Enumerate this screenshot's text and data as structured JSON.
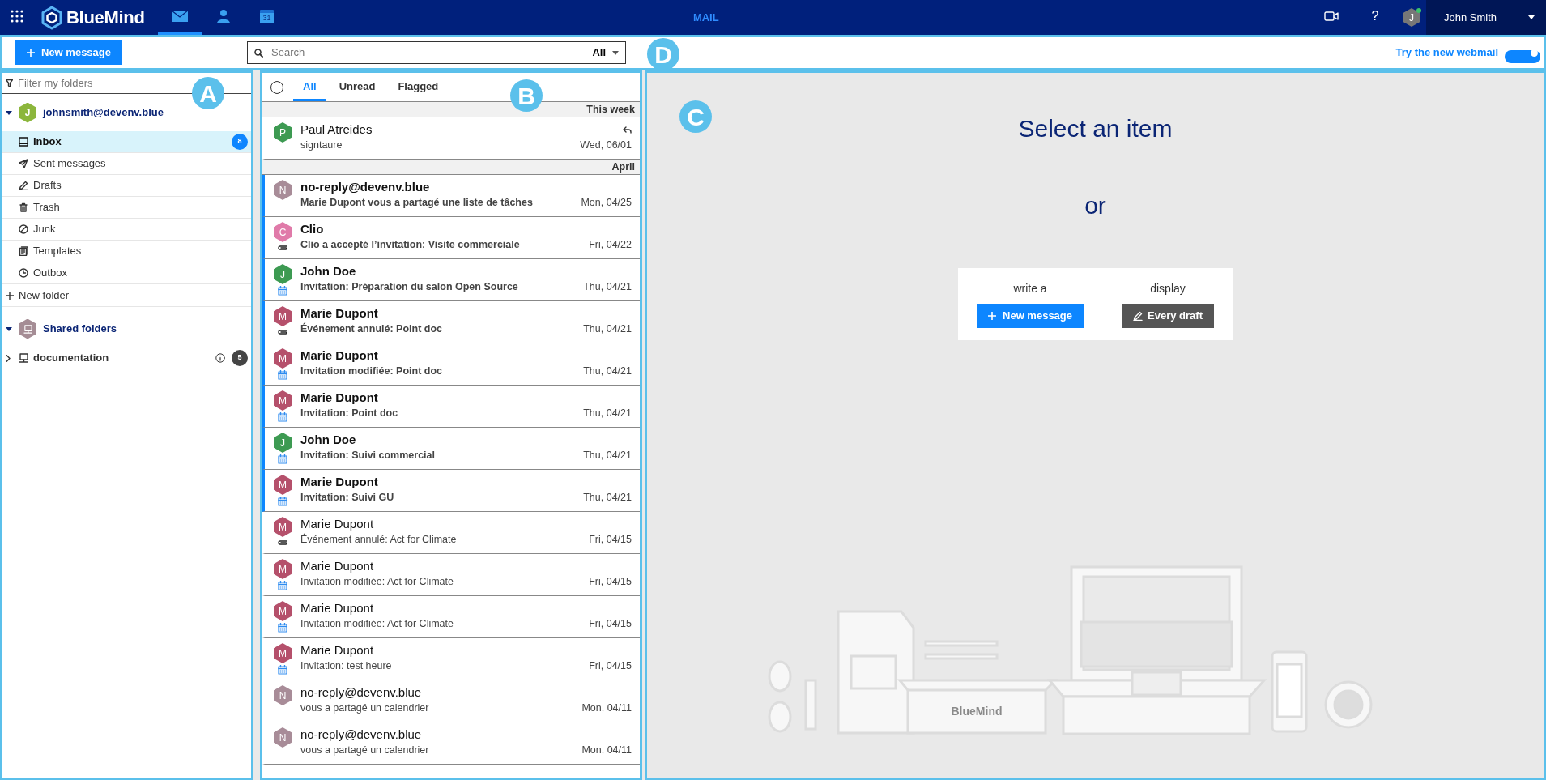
{
  "navbar": {
    "apps": [
      {
        "kind": "mail",
        "selected": true
      },
      {
        "kind": "contacts",
        "selected": false
      },
      {
        "kind": "calendar",
        "selected": false,
        "day": "31"
      }
    ],
    "logo": "BlueMind",
    "section": "MAIL",
    "help": "?",
    "user": {
      "initial": "J",
      "online": true,
      "name": "John Smith"
    }
  },
  "toolbar": {
    "callout": "D",
    "new_message": "New message",
    "search": {
      "placeholder": "Search",
      "scope": "All"
    },
    "new_webmail": {
      "label": "Try the new webmail",
      "on": true
    }
  },
  "sidebar": {
    "callout": "A",
    "filter_placeholder": "Filter my folders",
    "groups": [
      {
        "kind": "mailbox",
        "name": "johnsmith@devenv.blue",
        "initial": "J",
        "color": "#8cb63c",
        "expanded": true,
        "action": "New folder",
        "folders": [
          {
            "kind": "inbox",
            "label": "Inbox",
            "selected": true,
            "badge": "8"
          },
          {
            "kind": "sent",
            "label": "Sent messages",
            "selected": false
          },
          {
            "kind": "drafts",
            "label": "Drafts",
            "selected": false
          },
          {
            "kind": "trash",
            "label": "Trash",
            "selected": false
          },
          {
            "kind": "junk",
            "label": "Junk",
            "selected": false
          },
          {
            "kind": "templates",
            "label": "Templates",
            "selected": false
          },
          {
            "kind": "outbox",
            "label": "Outbox",
            "selected": false
          }
        ]
      },
      {
        "kind": "shared",
        "name": "Shared folders",
        "color": "#a58d95",
        "expanded": true,
        "folders": [
          {
            "kind": "shared",
            "label": "documentation",
            "selected": false,
            "expanded": false,
            "info": true,
            "badge": "5"
          }
        ]
      }
    ]
  },
  "message_list": {
    "callout": "B",
    "select_all": {
      "checked": false
    },
    "tabs": [
      {
        "label": "All",
        "selected": true
      },
      {
        "label": "Unread",
        "selected": false
      },
      {
        "label": "Flagged",
        "selected": false
      }
    ],
    "groups": [
      {
        "label": "This week",
        "messages": [
          {
            "initial": "P",
            "color": "#3d9a52",
            "sender": "Paul Atreides",
            "subject": "signtaure",
            "date": "Wed, 06/01",
            "unread": false,
            "replied": true,
            "kind": "plain"
          }
        ]
      },
      {
        "label": "April",
        "messages": [
          {
            "initial": "N",
            "color": "#a88c98",
            "sender": "no-reply@devenv.blue",
            "subject": "Marie Dupont vous a partagé une liste de tâches",
            "date": "Mon, 04/25",
            "unread": true,
            "replied": false,
            "kind": "plain"
          },
          {
            "initial": "C",
            "color": "#e07aa9",
            "sender": "Clio",
            "subject": "Clio a accepté l’invitation: Visite commerciale",
            "date": "Fri, 04/22",
            "unread": true,
            "replied": false,
            "kind": "attachment"
          },
          {
            "initial": "J",
            "color": "#3d9a52",
            "sender": "John Doe",
            "subject": "Invitation: Préparation du salon Open Source",
            "date": "Thu, 04/21",
            "unread": true,
            "replied": false,
            "kind": "event"
          },
          {
            "initial": "M",
            "color": "#b5506b",
            "sender": "Marie Dupont",
            "subject": "Événement annulé: Point doc",
            "date": "Thu, 04/21",
            "unread": true,
            "replied": false,
            "kind": "attachment"
          },
          {
            "initial": "M",
            "color": "#b5506b",
            "sender": "Marie Dupont",
            "subject": "Invitation modifiée: Point doc",
            "date": "Thu, 04/21",
            "unread": true,
            "replied": false,
            "kind": "event"
          },
          {
            "initial": "M",
            "color": "#b5506b",
            "sender": "Marie Dupont",
            "subject": "Invitation: Point doc",
            "date": "Thu, 04/21",
            "unread": true,
            "replied": false,
            "kind": "event"
          },
          {
            "initial": "J",
            "color": "#3d9a52",
            "sender": "John Doe",
            "subject": "Invitation: Suivi commercial",
            "date": "Thu, 04/21",
            "unread": true,
            "replied": false,
            "kind": "event"
          },
          {
            "initial": "M",
            "color": "#b5506b",
            "sender": "Marie Dupont",
            "subject": "Invitation: Suivi GU",
            "date": "Thu, 04/21",
            "unread": true,
            "replied": false,
            "kind": "event"
          },
          {
            "initial": "M",
            "color": "#b5506b",
            "sender": "Marie Dupont",
            "subject": "Événement annulé: Act for Climate",
            "date": "Fri, 04/15",
            "unread": false,
            "replied": false,
            "kind": "attachment"
          },
          {
            "initial": "M",
            "color": "#b5506b",
            "sender": "Marie Dupont",
            "subject": "Invitation modifiée: Act for Climate",
            "date": "Fri, 04/15",
            "unread": false,
            "replied": false,
            "kind": "event"
          },
          {
            "initial": "M",
            "color": "#b5506b",
            "sender": "Marie Dupont",
            "subject": "Invitation modifiée: Act for Climate",
            "date": "Fri, 04/15",
            "unread": false,
            "replied": false,
            "kind": "event"
          },
          {
            "initial": "M",
            "color": "#b5506b",
            "sender": "Marie Dupont",
            "subject": "Invitation: test heure",
            "date": "Fri, 04/15",
            "unread": false,
            "replied": false,
            "kind": "event"
          },
          {
            "initial": "N",
            "color": "#a88c98",
            "sender": "no-reply@devenv.blue",
            "subject": "vous a partagé un calendrier",
            "date": "Mon, 04/11",
            "unread": false,
            "replied": false,
            "kind": "plain"
          },
          {
            "initial": "N",
            "color": "#a88c98",
            "sender": "no-reply@devenv.blue",
            "subject": "vous a partagé un calendrier",
            "date": "Mon, 04/11",
            "unread": false,
            "replied": false,
            "kind": "plain"
          }
        ]
      }
    ]
  },
  "preview": {
    "callout": "C",
    "title": "Select an item",
    "or": "or",
    "actions": [
      {
        "kind": "new",
        "caption": "write a",
        "label": "New message"
      },
      {
        "kind": "drafts",
        "caption": "display",
        "label": "Every draft"
      }
    ],
    "illustration_label": "BlueMind"
  }
}
